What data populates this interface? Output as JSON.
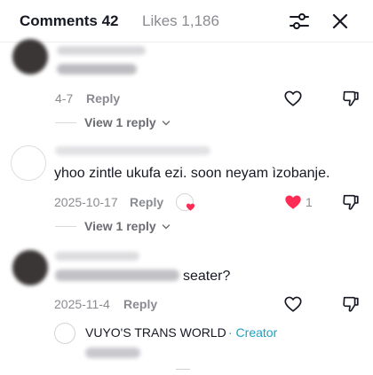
{
  "header": {
    "comments_label": "Comments 42",
    "likes_label": "Likes 1,186",
    "icons": [
      "filter-icon",
      "close-icon"
    ]
  },
  "comments": [
    {
      "date": "4-7",
      "reply_label": "Reply",
      "view_replies": "View 1 reply"
    },
    {
      "text": "yhoo zintle ukufa ezi. soon neyam ìzobanje.",
      "date": "2025-10-17",
      "reply_label": "Reply",
      "like_count": "1",
      "liked": true,
      "accent_color": "#fe2c55",
      "view_replies": "View 1 reply"
    },
    {
      "text_visible": "seater?",
      "date": "2025-11-4",
      "reply_label": "Reply"
    }
  ],
  "creator_reply": {
    "name": "VUYO'S TRANS WORLD",
    "tag": "· Creator",
    "tag_color": "#1da1c4"
  }
}
